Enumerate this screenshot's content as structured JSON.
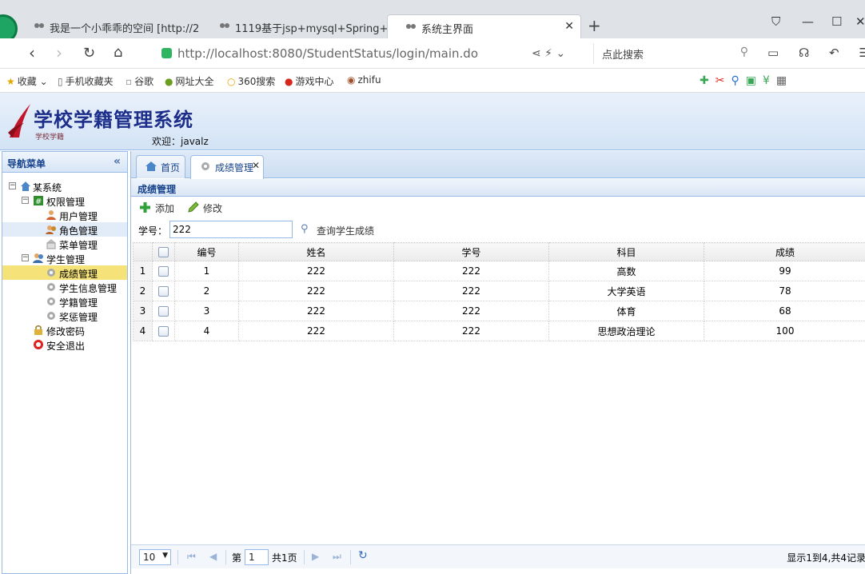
{
  "browser": {
    "tabs": [
      {
        "label": "我是一个小乖乖的空间 [http://2"
      },
      {
        "label": "1119基于jsp+mysql+Spring+n"
      },
      {
        "label": "系统主界面"
      }
    ],
    "url": "http://localhost:8080/StudentStatus/login/main.do",
    "search_placeholder": "点此搜索",
    "bookmarks": [
      {
        "label": "收藏"
      },
      {
        "label": "手机收藏夹"
      },
      {
        "label": "谷歌"
      },
      {
        "label": "网址大全"
      },
      {
        "label": "360搜索"
      },
      {
        "label": "游戏中心"
      },
      {
        "label": "zhifu"
      }
    ]
  },
  "header": {
    "title": "学校学籍管理系统",
    "subtitle": "学校学籍",
    "welcome": "欢迎：javalz"
  },
  "nav": {
    "title": "导航菜单",
    "items": [
      {
        "label": "某系统"
      },
      {
        "label": "权限管理"
      },
      {
        "label": "用户管理"
      },
      {
        "label": "角色管理"
      },
      {
        "label": "菜单管理"
      },
      {
        "label": "学生管理"
      },
      {
        "label": "成绩管理"
      },
      {
        "label": "学生信息管理"
      },
      {
        "label": "学籍管理"
      },
      {
        "label": "奖惩管理"
      },
      {
        "label": "修改密码"
      },
      {
        "label": "安全退出"
      }
    ]
  },
  "main": {
    "tabs": [
      {
        "label": "首页"
      },
      {
        "label": "成绩管理"
      }
    ],
    "panel_title": "成绩管理",
    "toolbar": {
      "add": "添加",
      "edit": "修改"
    },
    "search": {
      "label": "学号：",
      "value": "222",
      "button": "查询学生成绩"
    },
    "columns": [
      "编号",
      "姓名",
      "学号",
      "科目",
      "成绩"
    ],
    "rows": [
      {
        "n": "1",
        "id": "1",
        "name": "222",
        "sno": "222",
        "subject": "高数",
        "score": "99"
      },
      {
        "n": "2",
        "id": "2",
        "name": "222",
        "sno": "222",
        "subject": "大学英语",
        "score": "78"
      },
      {
        "n": "3",
        "id": "3",
        "name": "222",
        "sno": "222",
        "subject": "体育",
        "score": "68"
      },
      {
        "n": "4",
        "id": "4",
        "name": "222",
        "sno": "222",
        "subject": "思想政治理论",
        "score": "100"
      }
    ],
    "pager": {
      "page_size": "10",
      "page_label": "第",
      "page_value": "1",
      "total_pages": "共1页",
      "info": "显示1到4,共4记录"
    }
  },
  "colors": {
    "app_accent": "#15428b",
    "border": "#99bbe8",
    "selected_nav": "#f5e37a"
  }
}
